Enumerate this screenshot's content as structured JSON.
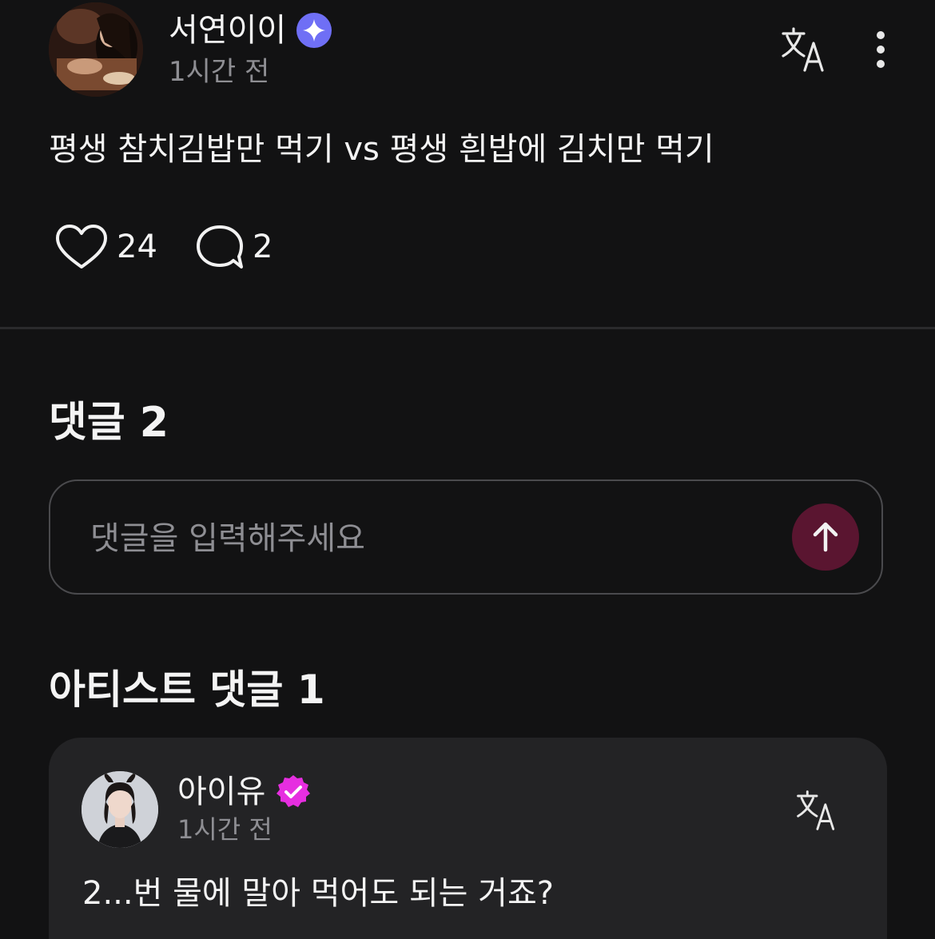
{
  "post": {
    "author": "서연이이",
    "time": "1시간 전",
    "body": "평생 참치김밥만 먹기 vs 평생 흰밥에 김치만 먹기",
    "like_count": "24",
    "comment_count": "2"
  },
  "comments": {
    "title": "댓글 2",
    "input_placeholder": "댓글을 입력해주세요"
  },
  "artist_comments": {
    "title": "아티스트 댓글 1",
    "items": [
      {
        "author": "아이유",
        "time": "1시간 전",
        "text": "2...번 물에 말아 먹어도 되는 거죠?"
      }
    ]
  },
  "icons": {
    "verified_user": "sparkle-badge-icon",
    "verified_artist": "check-badge-icon",
    "translate": "translate-icon",
    "more": "more-vertical-icon",
    "like": "heart-icon",
    "comment": "speech-bubble-icon",
    "send": "arrow-up-icon"
  },
  "colors": {
    "background": "#121213",
    "card": "#232325",
    "verified_blue": "#6f6ff5",
    "verified_pink": "#e62ee0",
    "send_button": "#5a1530",
    "muted_text": "#8e8e93"
  }
}
